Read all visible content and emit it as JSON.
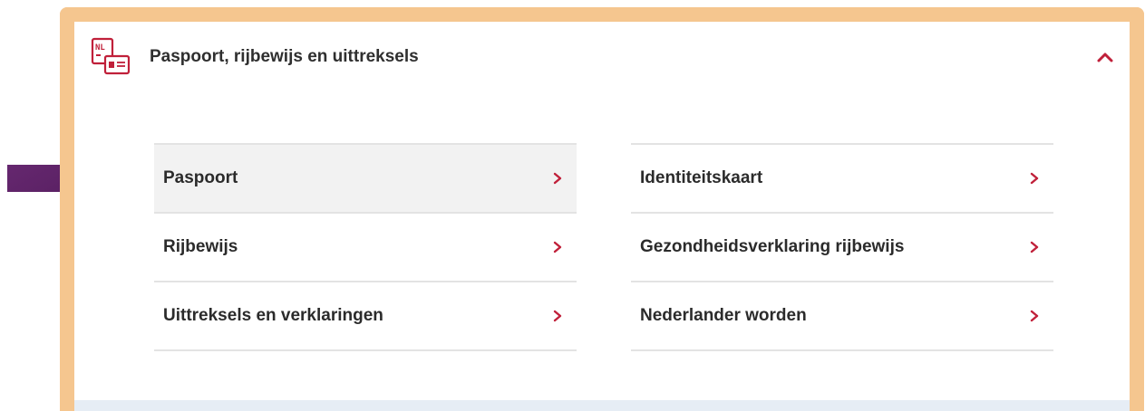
{
  "section": {
    "title": "Paspoort, rijbewijs en uittreksels",
    "icon": "passport-id-card-icon",
    "expanded": true
  },
  "colors": {
    "frame": "#f5c68f",
    "accent": "#c0203a",
    "arrow": "#5b1f64",
    "highlight_row": "#f2f2f2"
  },
  "links": {
    "left": [
      {
        "label": "Paspoort"
      },
      {
        "label": "Rijbewijs"
      },
      {
        "label": "Uittreksels en verklaringen"
      }
    ],
    "right": [
      {
        "label": "Identiteitskaart"
      },
      {
        "label": "Gezondheidsverklaring rijbewijs"
      },
      {
        "label": "Nederlander worden"
      }
    ]
  }
}
